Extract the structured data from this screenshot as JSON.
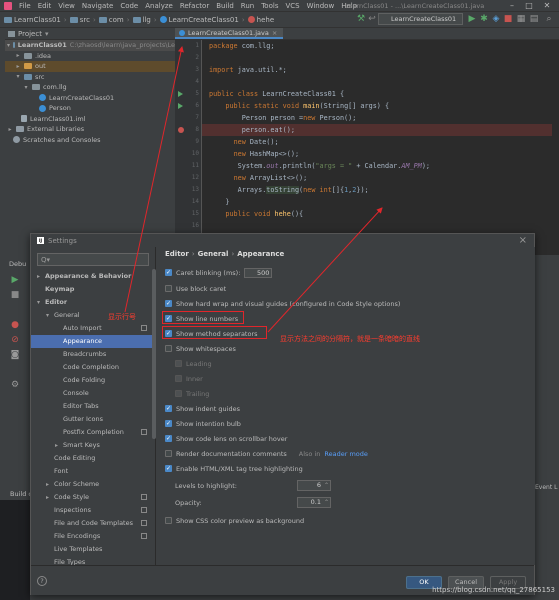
{
  "menubar": {
    "items": [
      "File",
      "Edit",
      "View",
      "Navigate",
      "Code",
      "Analyze",
      "Refactor",
      "Build",
      "Run",
      "Tools",
      "VCS",
      "Window",
      "Help"
    ],
    "window_title": "LearnClass01 - ...\\LearnCreateClass01.java"
  },
  "navbar": {
    "crumbs": [
      "LearnClass01",
      "src",
      "com",
      "llg",
      "LearnCreateClass01",
      "hehe"
    ],
    "run_config": "LearnCreateClass01"
  },
  "project": {
    "header": "Project",
    "tree": [
      {
        "label": "LearnClass01",
        "detail": "C:\\zhaosd\\learn\\java_projects\\Le",
        "level": 0,
        "arrow": "▾",
        "icon": "folder"
      },
      {
        "label": ".idea",
        "level": 1,
        "arrow": "▸",
        "icon": "folder"
      },
      {
        "label": "out",
        "level": 1,
        "arrow": "▸",
        "icon": "folder-out"
      },
      {
        "label": "src",
        "level": 1,
        "arrow": "▾",
        "icon": "folder"
      },
      {
        "label": "com.llg",
        "level": 2,
        "arrow": "▾",
        "icon": "package"
      },
      {
        "label": "LearnCreateClass01",
        "level": 3,
        "arrow": "",
        "icon": "class"
      },
      {
        "label": "Person",
        "level": 3,
        "arrow": "",
        "icon": "class"
      },
      {
        "label": "LearnClass01.iml",
        "level": 1,
        "arrow": "",
        "icon": "file"
      },
      {
        "label": "External Libraries",
        "level": 0,
        "arrow": "▸",
        "icon": "lib"
      },
      {
        "label": "Scratches and Consoles",
        "level": 0,
        "arrow": "",
        "icon": "scratch"
      }
    ]
  },
  "editor": {
    "tab": "LearnCreateClass01.java",
    "line_numbers": [
      "1",
      "2",
      "3",
      "4",
      "5",
      "6",
      "7",
      "8",
      "9",
      "10",
      "11",
      "12",
      "13",
      "14",
      "15",
      "16",
      "17"
    ]
  },
  "bottom": {
    "debug_label": "Debu",
    "build_label": "Build c",
    "event_log": "Event L"
  },
  "dialog": {
    "title": "Settings",
    "search_placeholder": "Q▾",
    "nav": [
      {
        "label": "Appearance & Behavior",
        "indent": 0,
        "arrow": "▸",
        "bold": true
      },
      {
        "label": "Keymap",
        "indent": 0,
        "arrow": "",
        "bold": true
      },
      {
        "label": "Editor",
        "indent": 0,
        "arrow": "▾",
        "bold": true
      },
      {
        "label": "General",
        "indent": 1,
        "arrow": "▾"
      },
      {
        "label": "Auto Import",
        "indent": 2,
        "arrow": "",
        "copy": true
      },
      {
        "label": "Appearance",
        "indent": 2,
        "arrow": "",
        "selected": true
      },
      {
        "label": "Breadcrumbs",
        "indent": 2,
        "arrow": ""
      },
      {
        "label": "Code Completion",
        "indent": 2,
        "arrow": ""
      },
      {
        "label": "Code Folding",
        "indent": 2,
        "arrow": ""
      },
      {
        "label": "Console",
        "indent": 2,
        "arrow": ""
      },
      {
        "label": "Editor Tabs",
        "indent": 2,
        "arrow": ""
      },
      {
        "label": "Gutter Icons",
        "indent": 2,
        "arrow": ""
      },
      {
        "label": "Postfix Completion",
        "indent": 2,
        "arrow": "",
        "copy": true
      },
      {
        "label": "Smart Keys",
        "indent": 2,
        "arrow": "▸"
      },
      {
        "label": "Code Editing",
        "indent": 1,
        "arrow": ""
      },
      {
        "label": "Font",
        "indent": 1,
        "arrow": ""
      },
      {
        "label": "Color Scheme",
        "indent": 1,
        "arrow": "▸"
      },
      {
        "label": "Code Style",
        "indent": 1,
        "arrow": "▸",
        "copy": true
      },
      {
        "label": "Inspections",
        "indent": 1,
        "arrow": "",
        "copy": true
      },
      {
        "label": "File and Code Templates",
        "indent": 1,
        "arrow": "",
        "copy": true
      },
      {
        "label": "File Encodings",
        "indent": 1,
        "arrow": "",
        "copy": true
      },
      {
        "label": "Live Templates",
        "indent": 1,
        "arrow": ""
      },
      {
        "label": "File Types",
        "indent": 1,
        "arrow": ""
      },
      {
        "label": "Android Layout Editor",
        "indent": 1,
        "arrow": ""
      }
    ],
    "breadcrumb": [
      "Editor",
      "General",
      "Appearance"
    ],
    "options": {
      "caret_blinking": {
        "label": "Caret blinking (ms):",
        "checked": true,
        "value": "500"
      },
      "block_caret": {
        "label": "Use block caret",
        "checked": false
      },
      "hard_wrap": {
        "label": "Show hard wrap and visual guides (configured in Code Style options)",
        "checked": true
      },
      "line_numbers": {
        "label": "Show line numbers",
        "checked": true
      },
      "method_separators": {
        "label": "Show method separators",
        "checked": true
      },
      "whitespaces": {
        "label": "Show whitespaces",
        "checked": false
      },
      "leading": {
        "label": "Leading",
        "checked": true
      },
      "inner": {
        "label": "Inner",
        "checked": true
      },
      "trailing": {
        "label": "Trailing",
        "checked": true
      },
      "indent_guides": {
        "label": "Show indent guides",
        "checked": true
      },
      "intention_bulb": {
        "label": "Show intention bulb",
        "checked": true
      },
      "code_lens": {
        "label": "Show code lens on scrollbar hover",
        "checked": true
      },
      "render_docs": {
        "label": "Render documentation comments",
        "checked": false,
        "note": "Also in",
        "link": "Reader mode"
      },
      "html_xml": {
        "label": "Enable HTML/XML tag tree highlighting",
        "checked": true
      },
      "levels": {
        "label": "Levels to highlight:",
        "value": "6"
      },
      "opacity": {
        "label": "Opacity:",
        "value": "0.1"
      },
      "css_color": {
        "label": "Show CSS color preview as background",
        "checked": false
      }
    },
    "buttons": {
      "ok": "OK",
      "cancel": "Cancel",
      "apply": "Apply",
      "help": "?"
    }
  },
  "annotations": {
    "line_numbers_note": "显示行号",
    "separators_note": "显示方法之间的分隔符，就是一条暗暗的直线",
    "color": "#e0262b"
  },
  "watermark": "https://blog.csdn.net/qq_27865153"
}
